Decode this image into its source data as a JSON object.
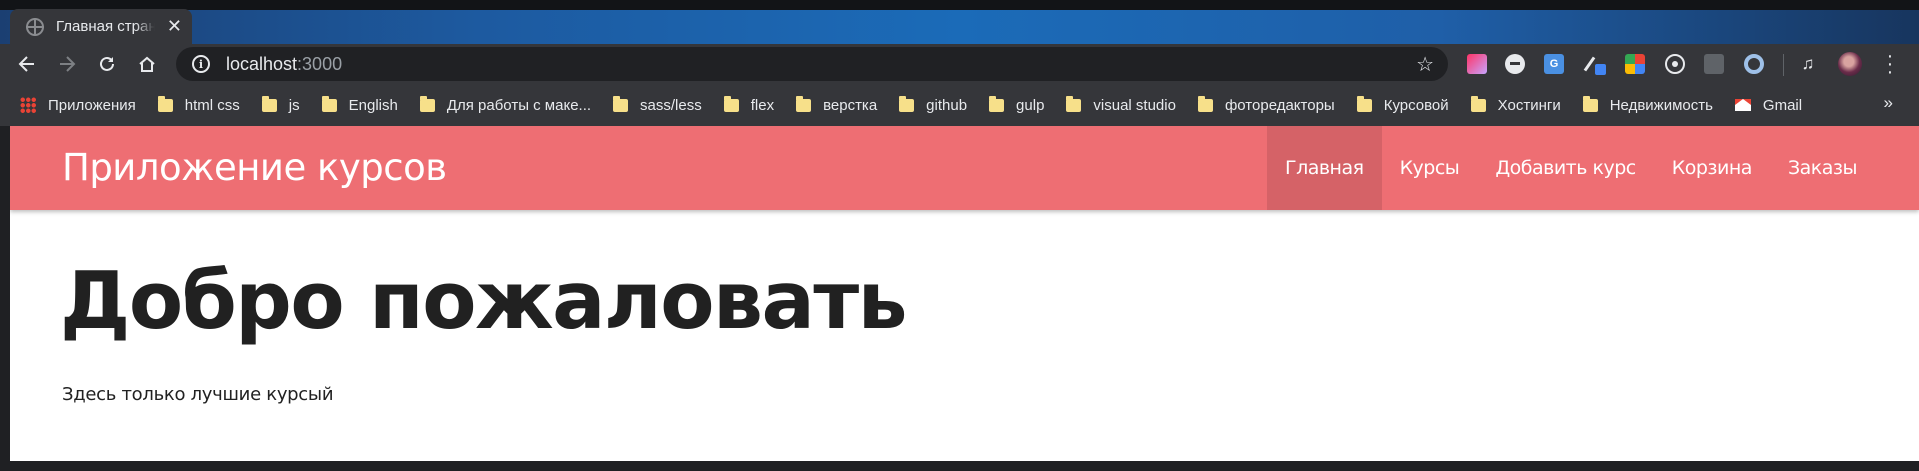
{
  "browser": {
    "tab": {
      "title": "Главная страница",
      "close": "✕"
    },
    "address_bar": {
      "host": "localhost",
      "port": ":3000"
    },
    "bookmarks": [
      {
        "label": "Приложения",
        "icon": "apps-grid-icon"
      },
      {
        "label": "html css",
        "icon": "folder-icon"
      },
      {
        "label": "js",
        "icon": "folder-icon"
      },
      {
        "label": "English",
        "icon": "folder-icon"
      },
      {
        "label": "Для работы с маке...",
        "icon": "folder-icon"
      },
      {
        "label": "sass/less",
        "icon": "folder-icon"
      },
      {
        "label": "flex",
        "icon": "folder-icon"
      },
      {
        "label": "верстка",
        "icon": "folder-icon"
      },
      {
        "label": "github",
        "icon": "folder-icon"
      },
      {
        "label": "gulp",
        "icon": "folder-icon"
      },
      {
        "label": "visual studio",
        "icon": "folder-icon"
      },
      {
        "label": "фоторедакторы",
        "icon": "folder-icon"
      },
      {
        "label": "Курсовой",
        "icon": "folder-icon"
      },
      {
        "label": "Хостинги",
        "icon": "folder-icon"
      },
      {
        "label": "Недвижимость",
        "icon": "folder-icon"
      },
      {
        "label": "Gmail",
        "icon": "gmail-icon"
      }
    ],
    "bookmarks_more": "»",
    "colors": {
      "tab_strip": "#1d5aa0",
      "toolbar": "#35363a",
      "omnibox": "#202124"
    }
  },
  "site": {
    "brand": "Приложение курсов",
    "nav": [
      {
        "label": "Главная",
        "active": true
      },
      {
        "label": "Курсы",
        "active": false
      },
      {
        "label": "Добавить курс",
        "active": false
      },
      {
        "label": "Корзина",
        "active": false
      },
      {
        "label": "Заказы",
        "active": false
      }
    ],
    "hero": {
      "title": "Добро пожаловать",
      "subtitle": "Здесь только лучшие курсый"
    },
    "colors": {
      "navbar": "#ee6e73",
      "text": "#212121"
    }
  }
}
